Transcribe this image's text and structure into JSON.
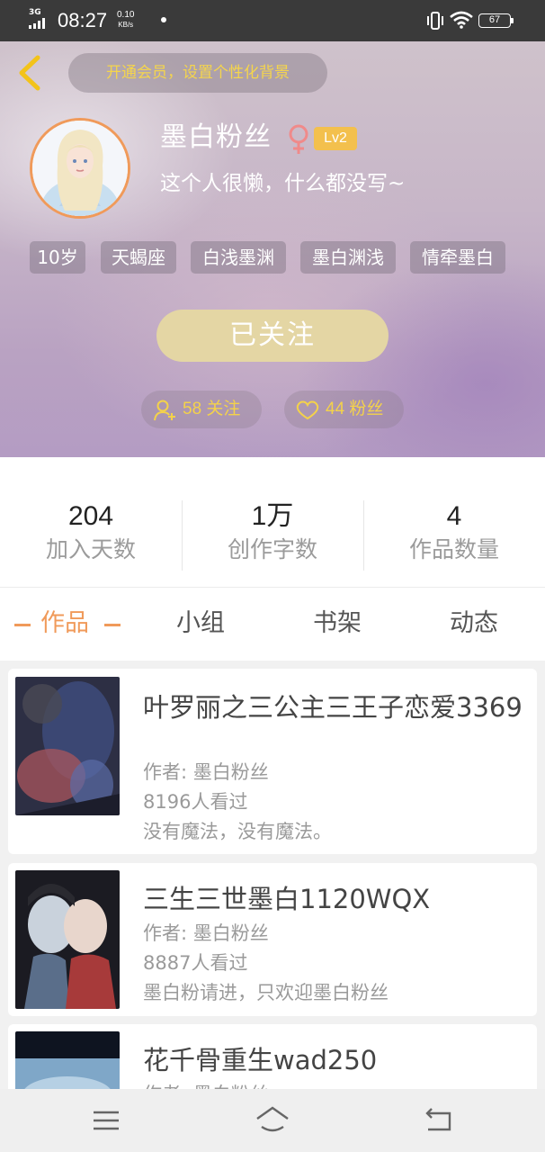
{
  "status_bar": {
    "network": "3G",
    "time": "08:27",
    "speed_value": "0.10",
    "speed_unit": "KB/s",
    "battery": "67"
  },
  "header": {
    "vip_banner": "开通会员，设置个性化背景",
    "username": "墨白粉丝",
    "level": "Lv2",
    "bio": "这个人很懒，什么都没写~",
    "tags": [
      "10岁",
      "天蝎座",
      "白浅墨渊",
      "墨白渊浅",
      "情牵墨白"
    ],
    "follow_button": "已关注",
    "following_label": "58 关注",
    "fans_label": "44 粉丝"
  },
  "stats": [
    {
      "value": "204",
      "label": "加入天数"
    },
    {
      "value": "1万",
      "label": "创作字数"
    },
    {
      "value": "4",
      "label": "作品数量"
    }
  ],
  "tabs": [
    "作品",
    "小组",
    "书架",
    "动态"
  ],
  "works": [
    {
      "title": "叶罗丽之三公主三王子恋爱3369",
      "author": "作者: 墨白粉丝",
      "views": "8196人看过",
      "desc": "没有魔法，没有魔法。"
    },
    {
      "title": "三生三世墨白1120WQX",
      "author": "作者: 墨白粉丝",
      "views": "8887人看过",
      "desc": "墨白粉请进，只欢迎墨白粉丝"
    },
    {
      "title": "花千骨重生wad250",
      "author": "作者: 墨白粉丝",
      "views": "",
      "desc": ""
    }
  ],
  "colors": {
    "accent": "#f09a5a",
    "gold": "#f4d24a",
    "follow_button": "#e4d6a4",
    "level_badge": "#f3c04d",
    "gender_female": "#f08a8a"
  },
  "icons": {
    "back": "chevron-left-icon",
    "gender": "female-icon",
    "following": "user-add-icon",
    "fans": "heart-icon",
    "nav_menu": "menu-icon",
    "nav_home": "home-icon",
    "nav_back": "back-arrow-icon"
  }
}
